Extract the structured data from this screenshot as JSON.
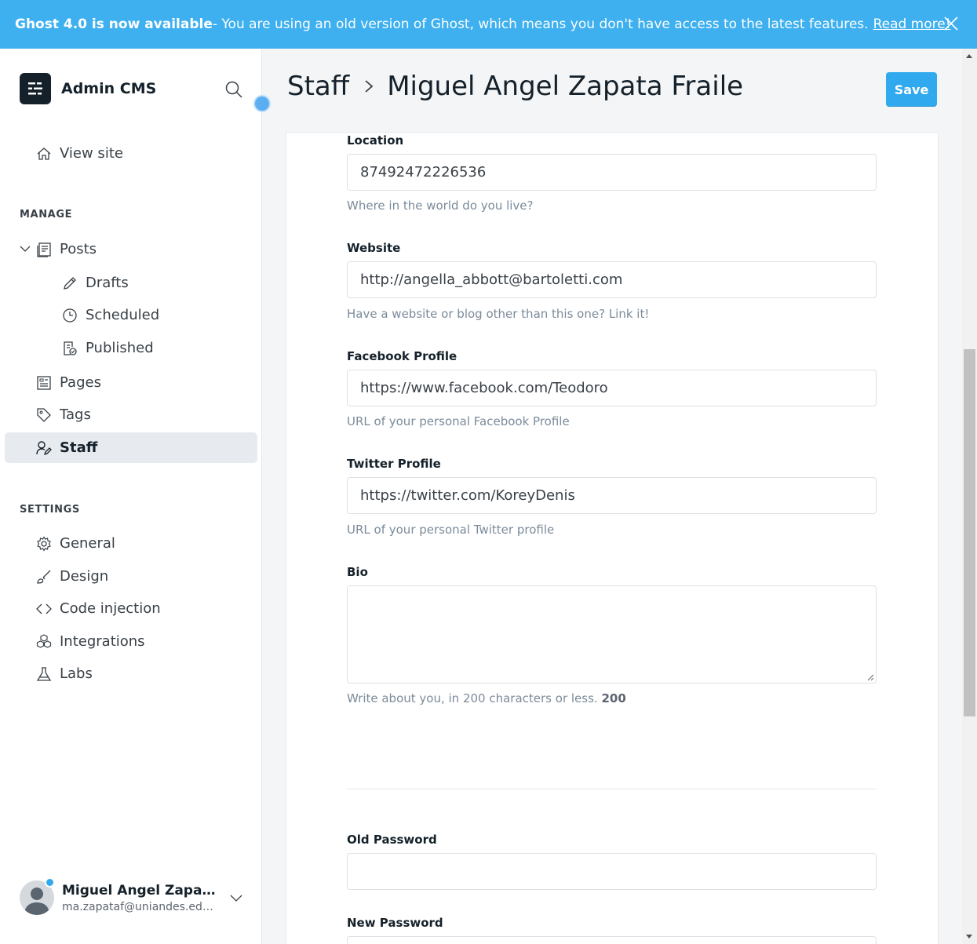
{
  "banner": {
    "title": "Ghost 4.0 is now available",
    "message": " - You are using an old version of Ghost, which means you don't have access to the latest features.",
    "link": "Read more!"
  },
  "sidebar": {
    "brand": "Admin CMS",
    "view_site": "View site",
    "manage_label": "MANAGE",
    "posts": "Posts",
    "drafts": "Drafts",
    "scheduled": "Scheduled",
    "published": "Published",
    "pages": "Pages",
    "tags": "Tags",
    "staff": "Staff",
    "settings_label": "SETTINGS",
    "general": "General",
    "design": "Design",
    "code_injection": "Code injection",
    "integrations": "Integrations",
    "labs": "Labs"
  },
  "user": {
    "name": "Miguel Angel Zapata F...",
    "email": "ma.zapataf@uniandes.edu..."
  },
  "header": {
    "crumb": "Staff",
    "title": "Miguel Angel Zapata Fraile",
    "save_label": "Save"
  },
  "form": {
    "location": {
      "label": "Location",
      "value": "87492472226536",
      "hint": "Where in the world do you live?"
    },
    "website": {
      "label": "Website",
      "value": "http://angella_abbott@bartoletti.com",
      "hint": "Have a website or blog other than this one? Link it!"
    },
    "facebook": {
      "label": "Facebook Profile",
      "value": "https://www.facebook.com/Teodoro",
      "hint": "URL of your personal Facebook Profile"
    },
    "twitter": {
      "label": "Twitter Profile",
      "value": "https://twitter.com/KoreyDenis",
      "hint": "URL of your personal Twitter profile"
    },
    "bio": {
      "label": "Bio",
      "value": "",
      "hint": "Write about you, in 200 characters or less.",
      "count": "200"
    },
    "old_password": {
      "label": "Old Password",
      "value": ""
    },
    "new_password": {
      "label": "New Password",
      "value": ""
    }
  },
  "colors": {
    "accent": "#30a9ee",
    "banner": "#3eb0ef",
    "text": "#15212a"
  }
}
